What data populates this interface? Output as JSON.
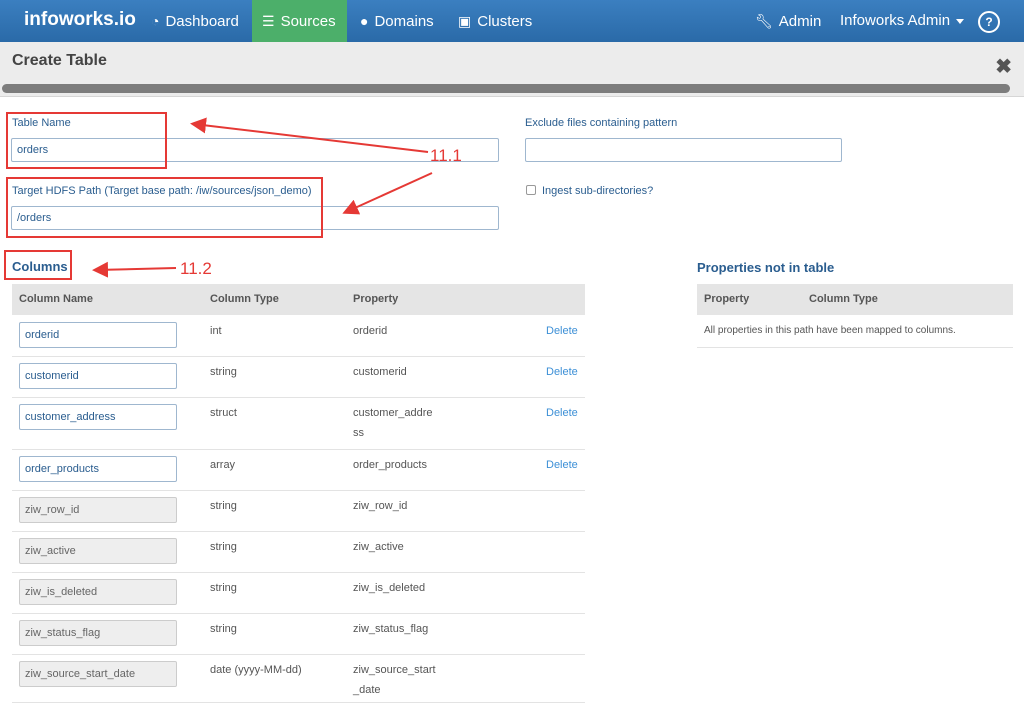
{
  "nav": {
    "brand": "infoworks.io",
    "items": [
      {
        "label": "Dashboard",
        "icon": "dashboard-icon"
      },
      {
        "label": "Sources",
        "icon": "database-icon"
      },
      {
        "label": "Domains",
        "icon": "globe-icon"
      },
      {
        "label": "Clusters",
        "icon": "cluster-icon"
      }
    ],
    "admin": "Admin",
    "user": "Infoworks Admin",
    "help": "?"
  },
  "page": {
    "title": "Create Table",
    "close": "✖"
  },
  "form": {
    "table_name_label": "Table Name",
    "table_name_value": "orders",
    "hdfs_label": "Target HDFS Path (Target base path: /iw/sources/json_demo)",
    "hdfs_value": "/orders",
    "exclude_label": "Exclude files containing pattern",
    "exclude_value": "",
    "ingest_label": "Ingest sub-directories?"
  },
  "annotations": {
    "a1": "11.1",
    "a2": "11.2"
  },
  "columns": {
    "title": "Columns",
    "headers": [
      "Column Name",
      "Column Type",
      "Property"
    ],
    "delete_label": "Delete",
    "rows": [
      {
        "name": "orderid",
        "type": "int",
        "prop": [
          "orderid"
        ],
        "editable": true
      },
      {
        "name": "customerid",
        "type": "string",
        "prop": [
          "customerid"
        ],
        "editable": true
      },
      {
        "name": "customer_address",
        "type": "struct",
        "prop": [
          "customer_addre",
          "ss"
        ],
        "editable": true
      },
      {
        "name": "order_products",
        "type": "array",
        "prop": [
          "order_products"
        ],
        "editable": true
      },
      {
        "name": "ziw_row_id",
        "type": "string",
        "prop": [
          "ziw_row_id"
        ],
        "editable": false
      },
      {
        "name": "ziw_active",
        "type": "string",
        "prop": [
          "ziw_active"
        ],
        "editable": false
      },
      {
        "name": "ziw_is_deleted",
        "type": "string",
        "prop": [
          "ziw_is_deleted"
        ],
        "editable": false
      },
      {
        "name": "ziw_status_flag",
        "type": "string",
        "prop": [
          "ziw_status_flag"
        ],
        "editable": false
      },
      {
        "name": "ziw_source_start_date",
        "type": "date (yyyy-MM-dd)",
        "prop": [
          "ziw_source_start",
          "_date"
        ],
        "editable": false
      }
    ]
  },
  "props": {
    "title": "Properties not in table",
    "headers": [
      "Property",
      "Column Type"
    ],
    "empty": "All properties in this path have been mapped to columns."
  },
  "colors": {
    "nav": "#2f73b4",
    "active": "#4caf6a",
    "link": "#3c8fd6",
    "annotation": "#e53935"
  }
}
